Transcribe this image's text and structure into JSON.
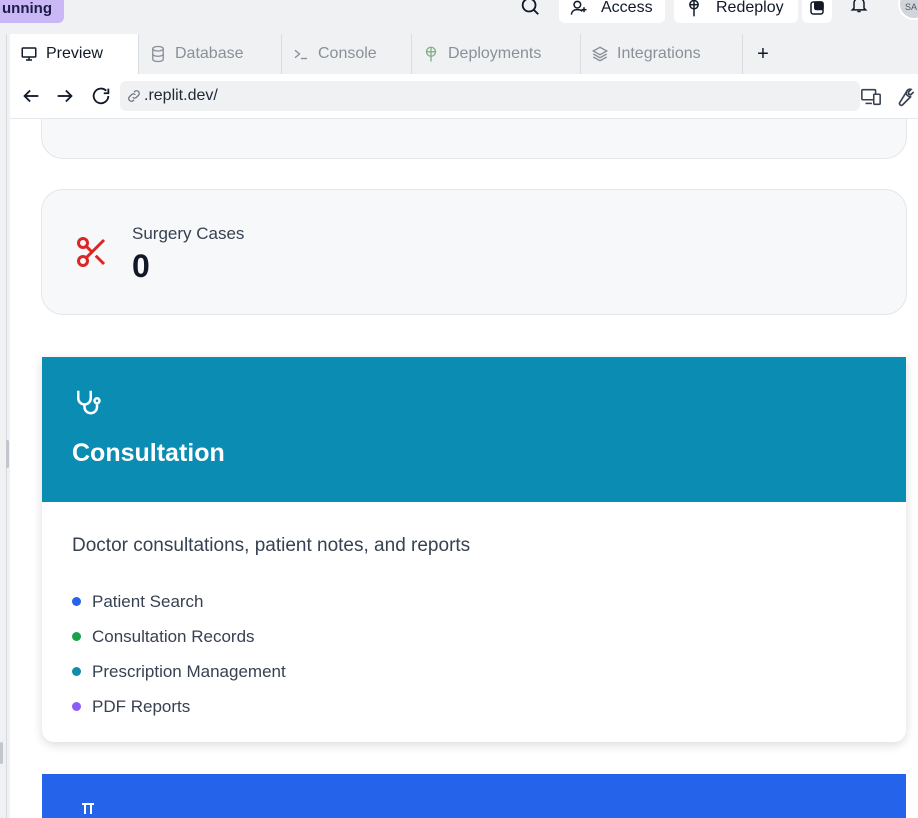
{
  "topbar": {
    "run_status": "unning",
    "access_label": "Access",
    "redeploy_label": "Redeploy",
    "avatar_initials": "SA"
  },
  "tabs": [
    {
      "label": "Preview"
    },
    {
      "label": "Database"
    },
    {
      "label": "Console"
    },
    {
      "label": "Deployments"
    },
    {
      "label": "Integrations"
    },
    {
      "label": "+"
    }
  ],
  "address_bar": {
    "url": ".replit.dev/"
  },
  "stat_card": {
    "label": "Surgery Cases",
    "value": "0",
    "icon": "scissors-icon",
    "icon_color": "#dc2626"
  },
  "module": {
    "title": "Consultation",
    "icon": "stethoscope-icon",
    "header_color": "#0b8cb3",
    "description": "Doctor consultations, patient notes, and reports",
    "features": [
      {
        "label": "Patient Search",
        "color": "#2563eb"
      },
      {
        "label": "Consultation Records",
        "color": "#16a34a"
      },
      {
        "label": "Prescription Management",
        "color": "#0e8fa8"
      },
      {
        "label": "PDF Reports",
        "color": "#8b5cf6"
      }
    ]
  },
  "next_module": {
    "header_color": "#2563eb",
    "icon": "flask-icon"
  }
}
